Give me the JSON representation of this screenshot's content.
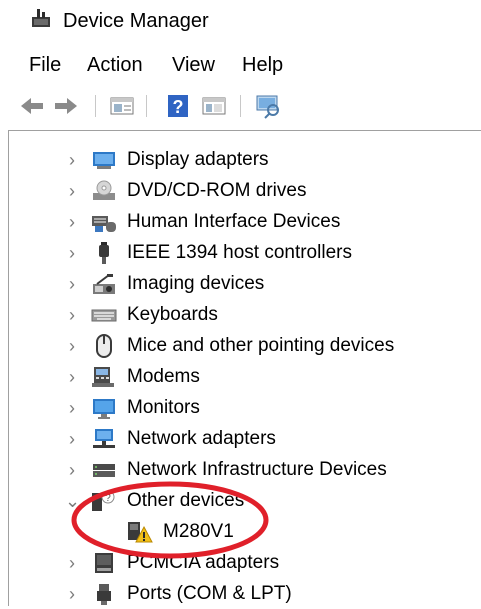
{
  "window": {
    "title": "Device Manager",
    "title_icon": "device-manager-icon"
  },
  "menu": {
    "items": [
      "File",
      "Action",
      "View",
      "Help"
    ]
  },
  "toolbar": {
    "buttons": [
      {
        "name": "back-button",
        "icon": "arrow-left-icon"
      },
      {
        "name": "forward-button",
        "icon": "arrow-right-icon"
      },
      {
        "name": "properties-button",
        "icon": "properties-icon"
      },
      {
        "name": "help-button",
        "icon": "help-icon"
      },
      {
        "name": "show-hide-button",
        "icon": "console-tree-icon"
      },
      {
        "name": "scan-button",
        "icon": "scan-hardware-icon"
      }
    ]
  },
  "tree": {
    "nodes": [
      {
        "label": "Display adapters",
        "icon": "display-adapter-icon",
        "expanded": false
      },
      {
        "label": "DVD/CD-ROM drives",
        "icon": "dvd-drive-icon",
        "expanded": false
      },
      {
        "label": "Human Interface Devices",
        "icon": "hid-icon",
        "expanded": false
      },
      {
        "label": "IEEE 1394 host controllers",
        "icon": "ieee1394-icon",
        "expanded": false
      },
      {
        "label": "Imaging devices",
        "icon": "camera-icon",
        "expanded": false
      },
      {
        "label": "Keyboards",
        "icon": "keyboard-icon",
        "expanded": false
      },
      {
        "label": "Mice and other pointing devices",
        "icon": "mouse-icon",
        "expanded": false
      },
      {
        "label": "Modems",
        "icon": "modem-icon",
        "expanded": false
      },
      {
        "label": "Monitors",
        "icon": "monitor-icon",
        "expanded": false
      },
      {
        "label": "Network adapters",
        "icon": "network-adapter-icon",
        "expanded": false
      },
      {
        "label": "Network Infrastructure Devices",
        "icon": "network-infrastructure-icon",
        "expanded": false
      },
      {
        "label": "Other devices",
        "icon": "unknown-device-icon",
        "expanded": true
      },
      {
        "label": "M280V1",
        "icon": "warning-device-icon",
        "child": true
      },
      {
        "label": "PCMCIA adapters",
        "icon": "pcmcia-icon",
        "expanded": false
      },
      {
        "label": "Ports (COM & LPT)",
        "icon": "port-icon",
        "expanded": false
      }
    ]
  },
  "annotation": {
    "highlight_color": "#e0202a"
  }
}
